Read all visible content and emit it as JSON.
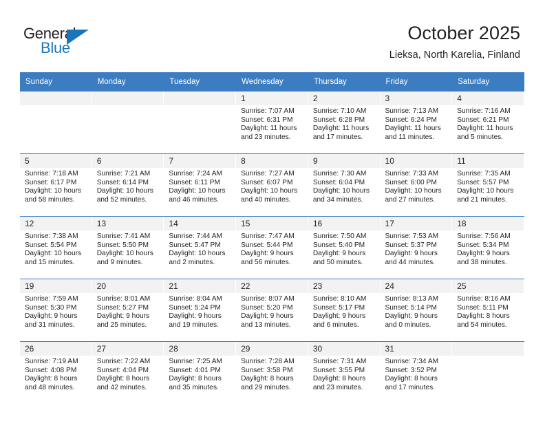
{
  "brand": {
    "name_part1": "General",
    "name_part2": "Blue",
    "accent_color": "#1b75bb"
  },
  "header": {
    "title": "October 2025",
    "location": "Lieksa, North Karelia, Finland"
  },
  "calendar": {
    "header_color": "#3b7dc0",
    "daynum_band_color": "#f2f2f2",
    "weekdays": [
      "Sunday",
      "Monday",
      "Tuesday",
      "Wednesday",
      "Thursday",
      "Friday",
      "Saturday"
    ],
    "weeks": [
      [
        {
          "day": "",
          "empty": true
        },
        {
          "day": "",
          "empty": true
        },
        {
          "day": "",
          "empty": true
        },
        {
          "day": "1",
          "sunrise": "Sunrise: 7:07 AM",
          "sunset": "Sunset: 6:31 PM",
          "daylight1": "Daylight: 11 hours",
          "daylight2": "and 23 minutes."
        },
        {
          "day": "2",
          "sunrise": "Sunrise: 7:10 AM",
          "sunset": "Sunset: 6:28 PM",
          "daylight1": "Daylight: 11 hours",
          "daylight2": "and 17 minutes."
        },
        {
          "day": "3",
          "sunrise": "Sunrise: 7:13 AM",
          "sunset": "Sunset: 6:24 PM",
          "daylight1": "Daylight: 11 hours",
          "daylight2": "and 11 minutes."
        },
        {
          "day": "4",
          "sunrise": "Sunrise: 7:16 AM",
          "sunset": "Sunset: 6:21 PM",
          "daylight1": "Daylight: 11 hours",
          "daylight2": "and 5 minutes."
        }
      ],
      [
        {
          "day": "5",
          "sunrise": "Sunrise: 7:18 AM",
          "sunset": "Sunset: 6:17 PM",
          "daylight1": "Daylight: 10 hours",
          "daylight2": "and 58 minutes."
        },
        {
          "day": "6",
          "sunrise": "Sunrise: 7:21 AM",
          "sunset": "Sunset: 6:14 PM",
          "daylight1": "Daylight: 10 hours",
          "daylight2": "and 52 minutes."
        },
        {
          "day": "7",
          "sunrise": "Sunrise: 7:24 AM",
          "sunset": "Sunset: 6:11 PM",
          "daylight1": "Daylight: 10 hours",
          "daylight2": "and 46 minutes."
        },
        {
          "day": "8",
          "sunrise": "Sunrise: 7:27 AM",
          "sunset": "Sunset: 6:07 PM",
          "daylight1": "Daylight: 10 hours",
          "daylight2": "and 40 minutes."
        },
        {
          "day": "9",
          "sunrise": "Sunrise: 7:30 AM",
          "sunset": "Sunset: 6:04 PM",
          "daylight1": "Daylight: 10 hours",
          "daylight2": "and 34 minutes."
        },
        {
          "day": "10",
          "sunrise": "Sunrise: 7:33 AM",
          "sunset": "Sunset: 6:00 PM",
          "daylight1": "Daylight: 10 hours",
          "daylight2": "and 27 minutes."
        },
        {
          "day": "11",
          "sunrise": "Sunrise: 7:35 AM",
          "sunset": "Sunset: 5:57 PM",
          "daylight1": "Daylight: 10 hours",
          "daylight2": "and 21 minutes."
        }
      ],
      [
        {
          "day": "12",
          "sunrise": "Sunrise: 7:38 AM",
          "sunset": "Sunset: 5:54 PM",
          "daylight1": "Daylight: 10 hours",
          "daylight2": "and 15 minutes."
        },
        {
          "day": "13",
          "sunrise": "Sunrise: 7:41 AM",
          "sunset": "Sunset: 5:50 PM",
          "daylight1": "Daylight: 10 hours",
          "daylight2": "and 9 minutes."
        },
        {
          "day": "14",
          "sunrise": "Sunrise: 7:44 AM",
          "sunset": "Sunset: 5:47 PM",
          "daylight1": "Daylight: 10 hours",
          "daylight2": "and 2 minutes."
        },
        {
          "day": "15",
          "sunrise": "Sunrise: 7:47 AM",
          "sunset": "Sunset: 5:44 PM",
          "daylight1": "Daylight: 9 hours",
          "daylight2": "and 56 minutes."
        },
        {
          "day": "16",
          "sunrise": "Sunrise: 7:50 AM",
          "sunset": "Sunset: 5:40 PM",
          "daylight1": "Daylight: 9 hours",
          "daylight2": "and 50 minutes."
        },
        {
          "day": "17",
          "sunrise": "Sunrise: 7:53 AM",
          "sunset": "Sunset: 5:37 PM",
          "daylight1": "Daylight: 9 hours",
          "daylight2": "and 44 minutes."
        },
        {
          "day": "18",
          "sunrise": "Sunrise: 7:56 AM",
          "sunset": "Sunset: 5:34 PM",
          "daylight1": "Daylight: 9 hours",
          "daylight2": "and 38 minutes."
        }
      ],
      [
        {
          "day": "19",
          "sunrise": "Sunrise: 7:59 AM",
          "sunset": "Sunset: 5:30 PM",
          "daylight1": "Daylight: 9 hours",
          "daylight2": "and 31 minutes."
        },
        {
          "day": "20",
          "sunrise": "Sunrise: 8:01 AM",
          "sunset": "Sunset: 5:27 PM",
          "daylight1": "Daylight: 9 hours",
          "daylight2": "and 25 minutes."
        },
        {
          "day": "21",
          "sunrise": "Sunrise: 8:04 AM",
          "sunset": "Sunset: 5:24 PM",
          "daylight1": "Daylight: 9 hours",
          "daylight2": "and 19 minutes."
        },
        {
          "day": "22",
          "sunrise": "Sunrise: 8:07 AM",
          "sunset": "Sunset: 5:20 PM",
          "daylight1": "Daylight: 9 hours",
          "daylight2": "and 13 minutes."
        },
        {
          "day": "23",
          "sunrise": "Sunrise: 8:10 AM",
          "sunset": "Sunset: 5:17 PM",
          "daylight1": "Daylight: 9 hours",
          "daylight2": "and 6 minutes."
        },
        {
          "day": "24",
          "sunrise": "Sunrise: 8:13 AM",
          "sunset": "Sunset: 5:14 PM",
          "daylight1": "Daylight: 9 hours",
          "daylight2": "and 0 minutes."
        },
        {
          "day": "25",
          "sunrise": "Sunrise: 8:16 AM",
          "sunset": "Sunset: 5:11 PM",
          "daylight1": "Daylight: 8 hours",
          "daylight2": "and 54 minutes."
        }
      ],
      [
        {
          "day": "26",
          "sunrise": "Sunrise: 7:19 AM",
          "sunset": "Sunset: 4:08 PM",
          "daylight1": "Daylight: 8 hours",
          "daylight2": "and 48 minutes."
        },
        {
          "day": "27",
          "sunrise": "Sunrise: 7:22 AM",
          "sunset": "Sunset: 4:04 PM",
          "daylight1": "Daylight: 8 hours",
          "daylight2": "and 42 minutes."
        },
        {
          "day": "28",
          "sunrise": "Sunrise: 7:25 AM",
          "sunset": "Sunset: 4:01 PM",
          "daylight1": "Daylight: 8 hours",
          "daylight2": "and 35 minutes."
        },
        {
          "day": "29",
          "sunrise": "Sunrise: 7:28 AM",
          "sunset": "Sunset: 3:58 PM",
          "daylight1": "Daylight: 8 hours",
          "daylight2": "and 29 minutes."
        },
        {
          "day": "30",
          "sunrise": "Sunrise: 7:31 AM",
          "sunset": "Sunset: 3:55 PM",
          "daylight1": "Daylight: 8 hours",
          "daylight2": "and 23 minutes."
        },
        {
          "day": "31",
          "sunrise": "Sunrise: 7:34 AM",
          "sunset": "Sunset: 3:52 PM",
          "daylight1": "Daylight: 8 hours",
          "daylight2": "and 17 minutes."
        },
        {
          "day": "",
          "empty": true
        }
      ]
    ]
  }
}
